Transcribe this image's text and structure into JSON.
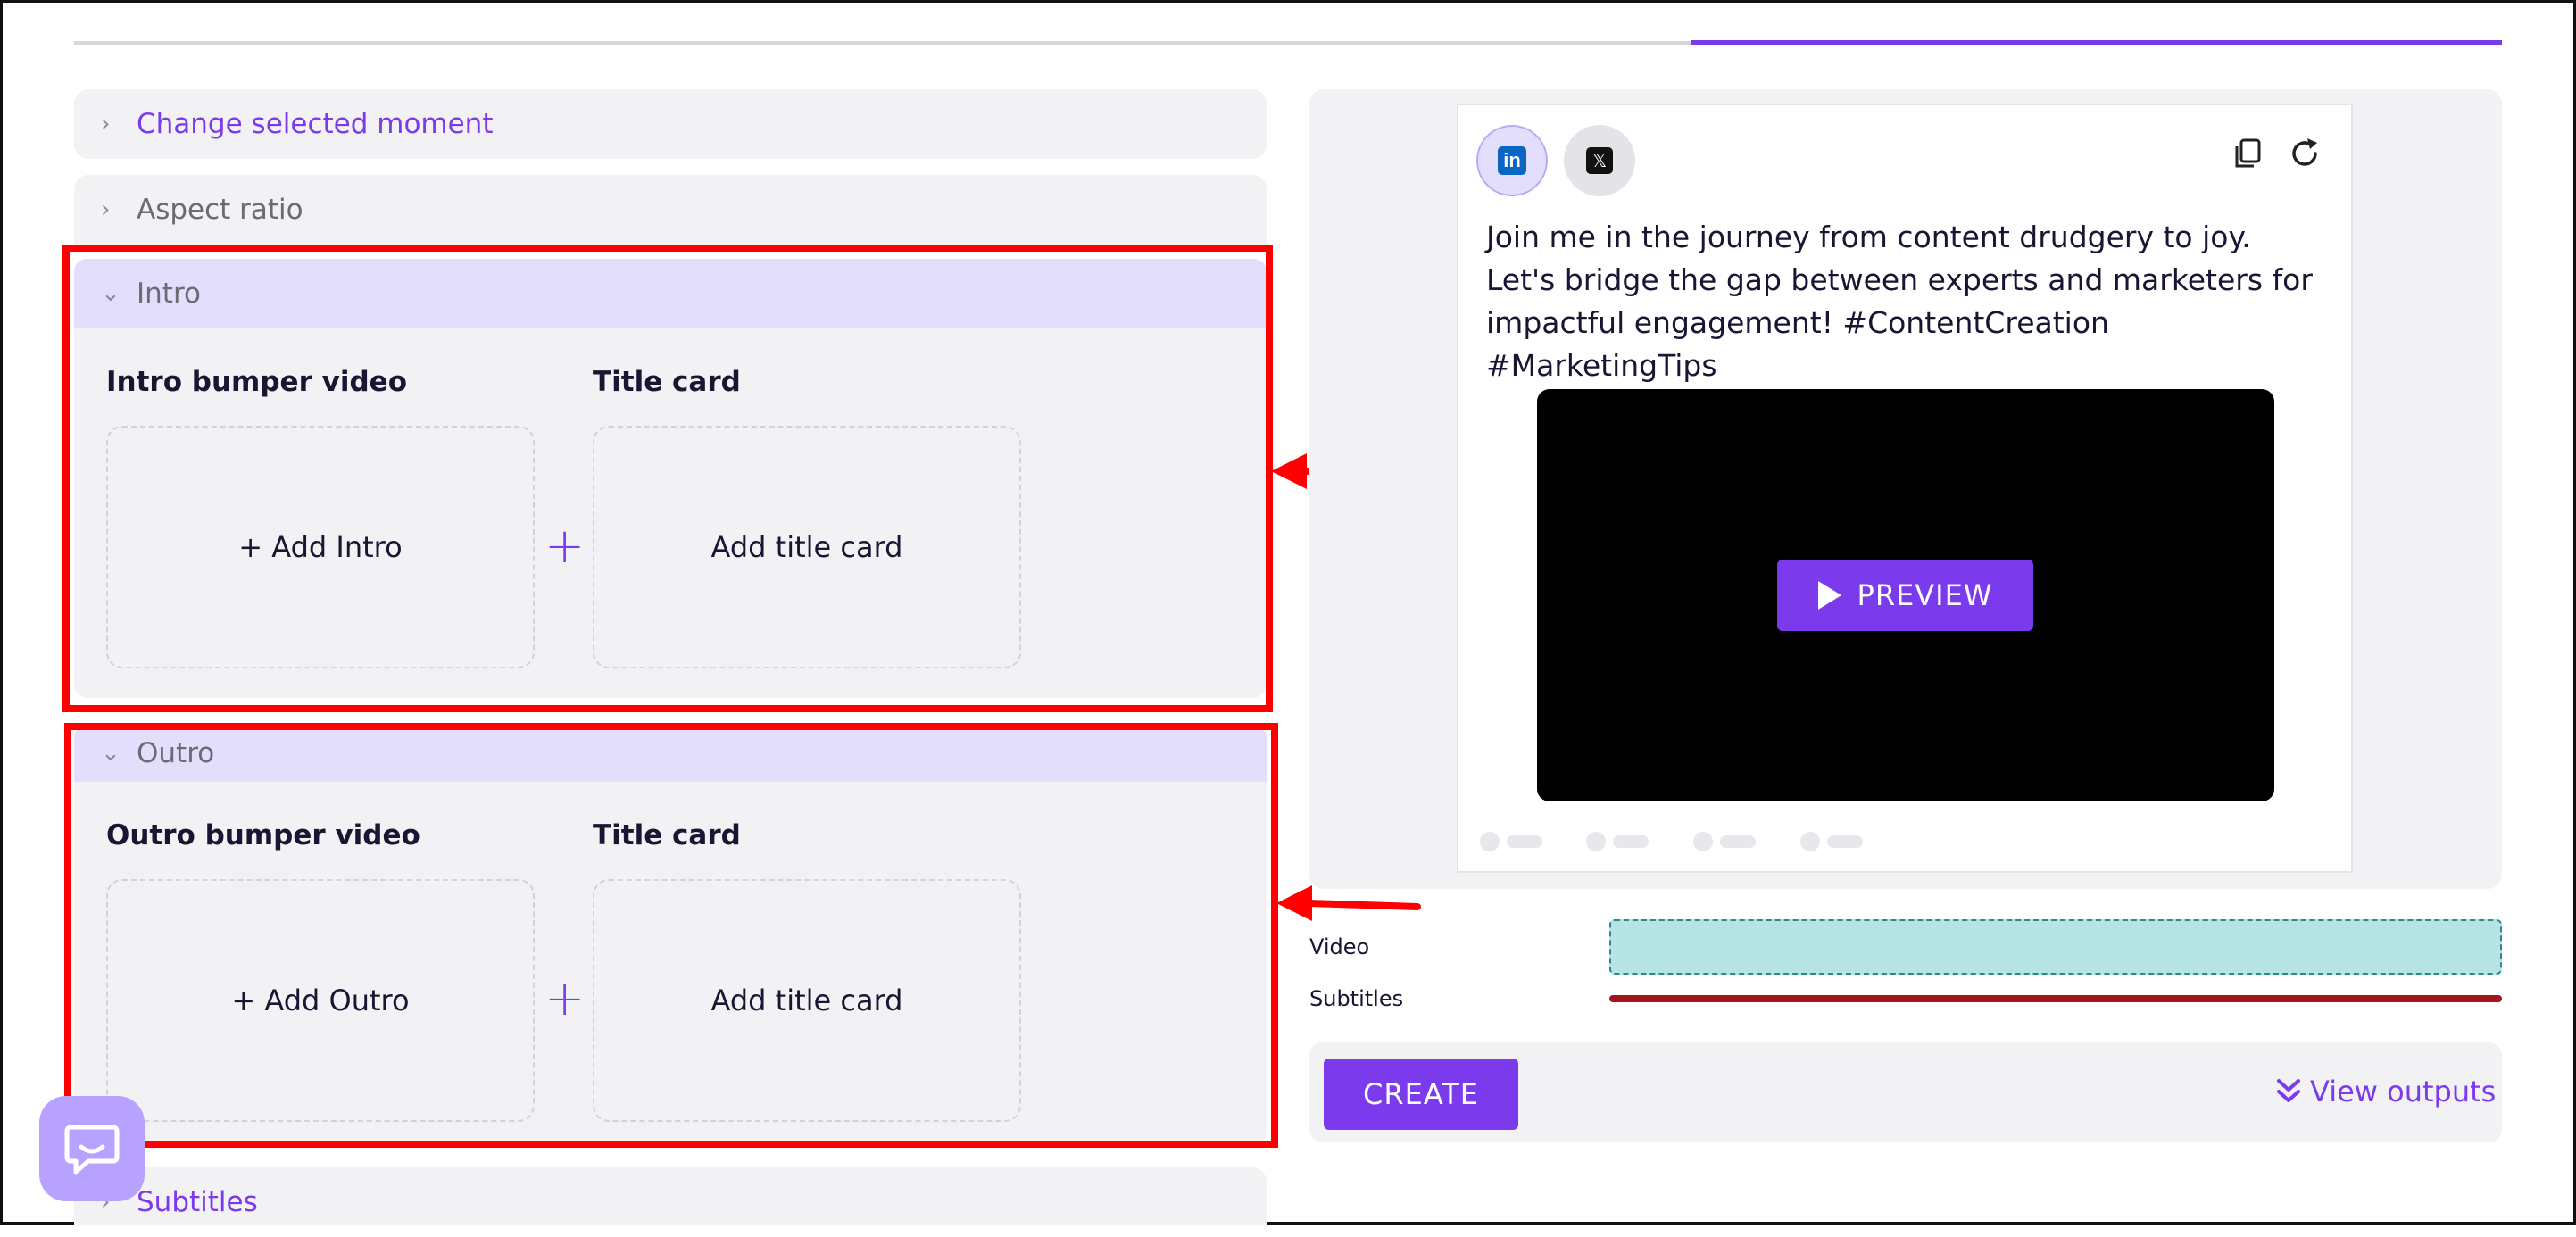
{
  "accordion": {
    "change_moment": "Change selected moment",
    "aspect_ratio": "Aspect ratio",
    "intro": {
      "label": "Intro",
      "bumper_title": "Intro bumper video",
      "title_card_title": "Title card",
      "add_bumper": "+ Add Intro",
      "add_title_card": "Add title card"
    },
    "outro": {
      "label": "Outro",
      "bumper_title": "Outro bumper video",
      "title_card_title": "Title card",
      "add_bumper": "+ Add Outro",
      "add_title_card": "Add title card"
    },
    "subtitles": "Subtitles"
  },
  "preview": {
    "post_text": "Join me in the journey from content drudgery to joy. Let's bridge the gap between experts and marketers for impactful engagement! #ContentCreation #MarketingTips",
    "preview_button": "PREVIEW",
    "social": [
      "linkedin-icon",
      "x-icon"
    ]
  },
  "tracks": {
    "video_label": "Video",
    "subtitles_label": "Subtitles",
    "video_color": "#b6e3e3",
    "subtitles_color": "#a1151f"
  },
  "actions": {
    "create": "CREATE",
    "view_outputs": "View outputs"
  },
  "colors": {
    "accent": "#7c3aed",
    "highlight": "#ff0000",
    "panel": "#f2f2f4"
  }
}
